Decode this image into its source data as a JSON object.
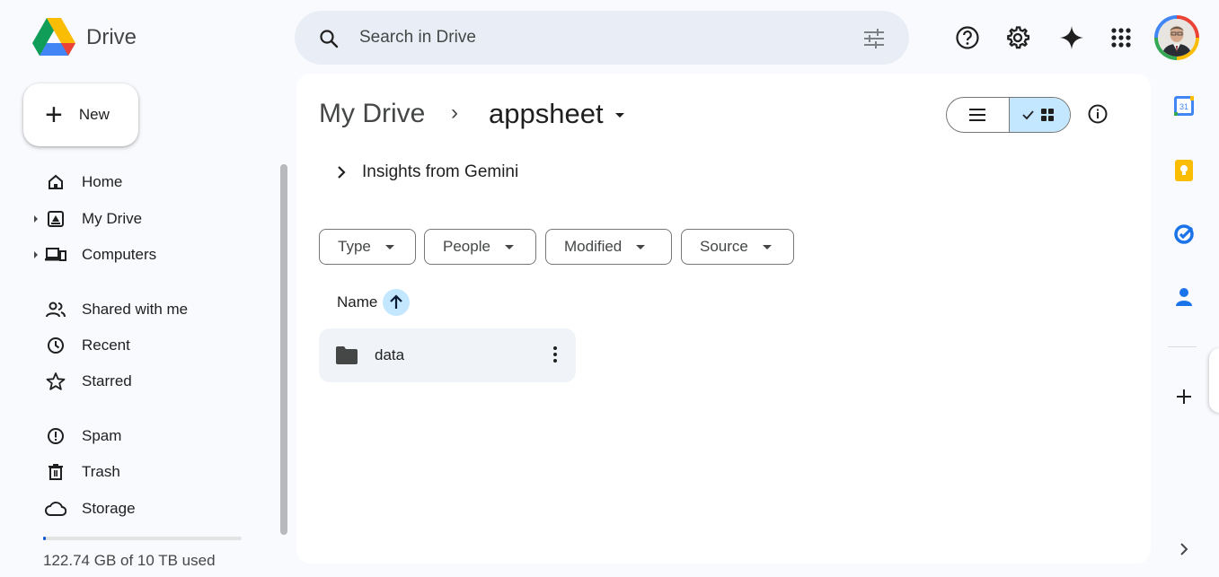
{
  "app": {
    "name": "Drive"
  },
  "search": {
    "placeholder": "Search in Drive"
  },
  "sidebar": {
    "new_label": "New",
    "items": [
      {
        "label": "Home"
      },
      {
        "label": "My Drive"
      },
      {
        "label": "Computers"
      },
      {
        "label": "Shared with me"
      },
      {
        "label": "Recent"
      },
      {
        "label": "Starred"
      },
      {
        "label": "Spam"
      },
      {
        "label": "Trash"
      },
      {
        "label": "Storage"
      }
    ],
    "storage_text": "122.74 GB of 10 TB used",
    "storage_fraction": 0.012
  },
  "breadcrumb": {
    "root": "My Drive",
    "separator": "›",
    "current": "appsheet"
  },
  "insights": {
    "label": "Insights from Gemini"
  },
  "filters": [
    {
      "label": "Type"
    },
    {
      "label": "People"
    },
    {
      "label": "Modified"
    },
    {
      "label": "Source"
    }
  ],
  "list": {
    "sort_label": "Name",
    "items": [
      {
        "name": "data",
        "type": "folder"
      }
    ]
  },
  "view_mode": "grid",
  "rail": {
    "calendar_day": "31"
  },
  "colors": {
    "accent": "#0b57d0",
    "selected": "#c2e7ff",
    "search_bg": "#e9eef6"
  }
}
